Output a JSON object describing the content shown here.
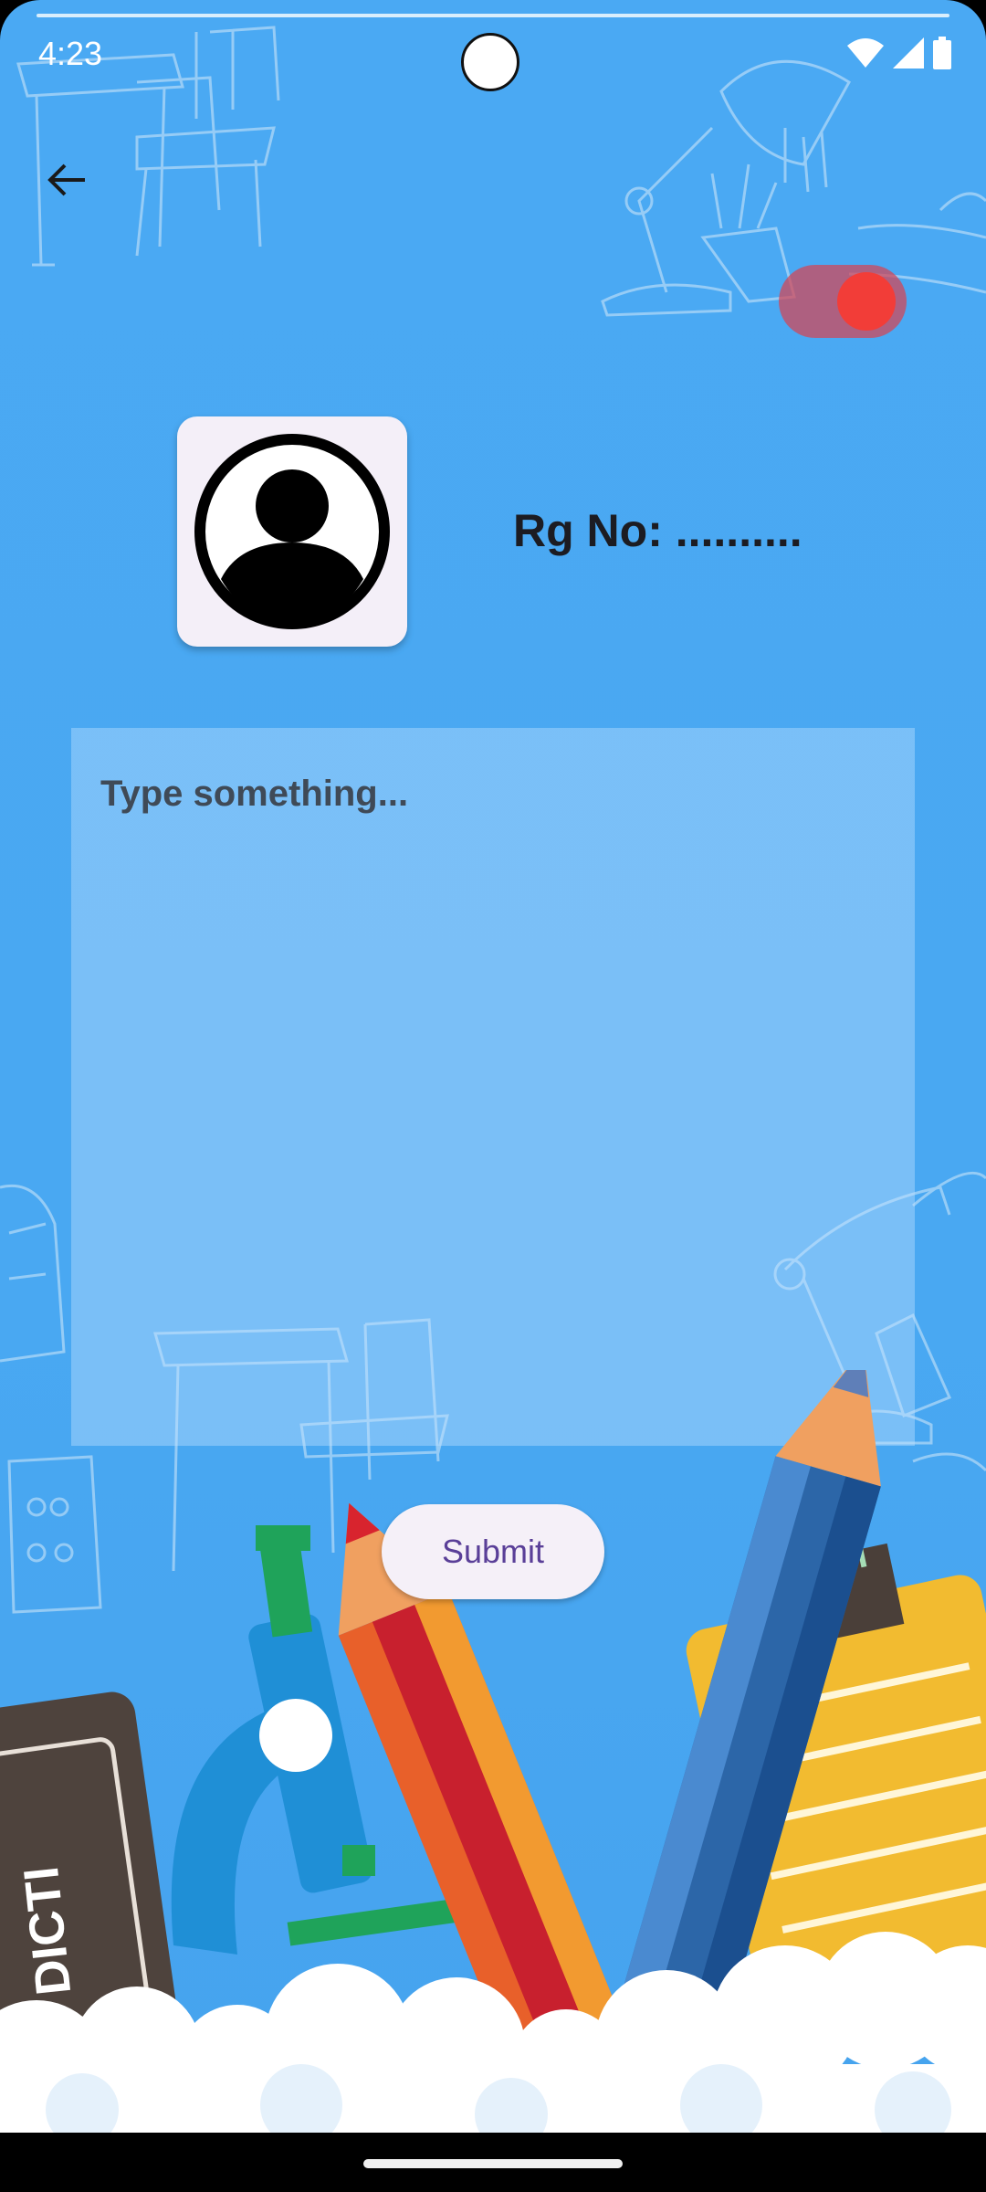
{
  "status_bar": {
    "time": "4:23"
  },
  "header": {
    "back_icon": "arrow-left-icon"
  },
  "toggle": {
    "state": "on",
    "thumb_color": "#f23d38",
    "track_color": "#d0485a"
  },
  "profile": {
    "avatar_icon": "account-circle-icon",
    "reg_label": "Rg No: .........."
  },
  "note": {
    "placeholder": "Type something...",
    "value": ""
  },
  "actions": {
    "submit_label": "Submit"
  },
  "decoration": {
    "book_label": "DICTI"
  },
  "colors": {
    "background": "#4aa9f3",
    "button_text": "#5a3f98"
  }
}
